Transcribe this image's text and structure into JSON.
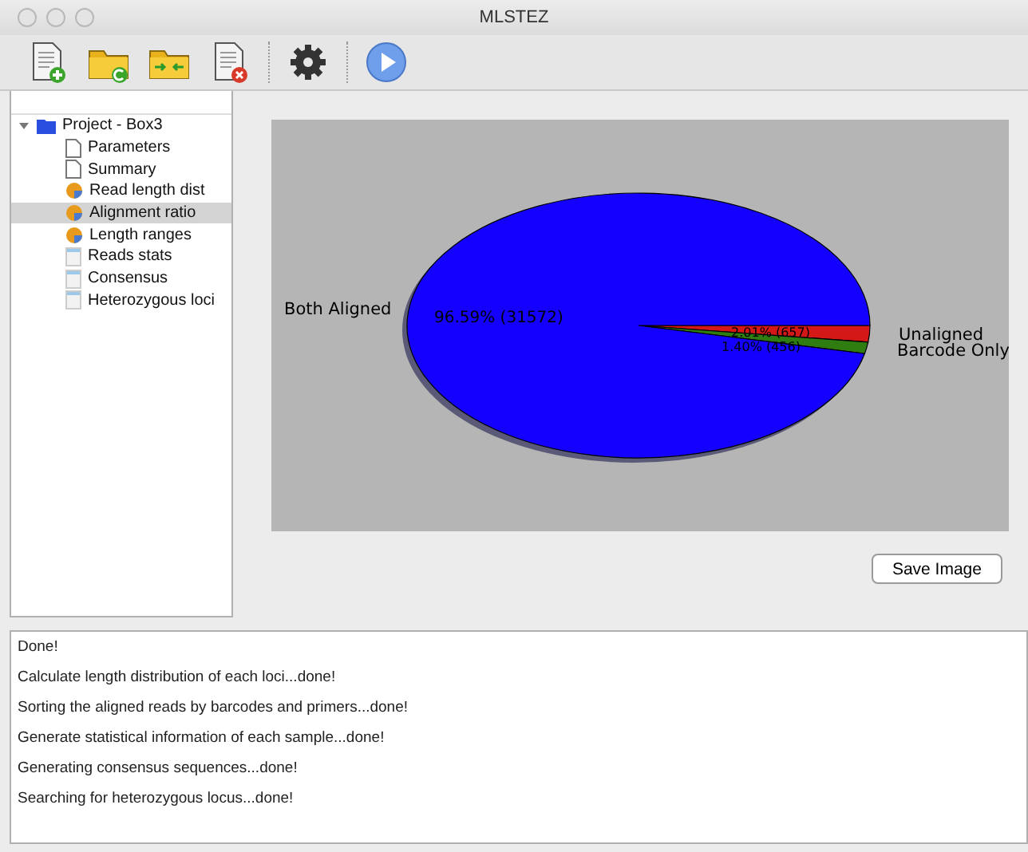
{
  "window": {
    "title": "MLSTEZ"
  },
  "toolbar": [
    {
      "kind": "new-file"
    },
    {
      "kind": "open-folder"
    },
    {
      "kind": "merge-folder"
    },
    {
      "kind": "delete-file"
    },
    {
      "kind": "settings"
    },
    {
      "kind": "run"
    }
  ],
  "tree": {
    "label": "Project - Box3",
    "expanded": true,
    "children": [
      {
        "label": "Parameters",
        "kind": "page",
        "selected": false
      },
      {
        "label": "Summary",
        "kind": "page",
        "selected": false
      },
      {
        "label": "Read length dist",
        "kind": "chart",
        "selected": false
      },
      {
        "label": "Alignment ratio",
        "kind": "chart",
        "selected": true
      },
      {
        "label": "Length ranges",
        "kind": "chart",
        "selected": false
      },
      {
        "label": "Reads stats",
        "kind": "sheet",
        "selected": false
      },
      {
        "label": "Consensus",
        "kind": "sheet",
        "selected": false
      },
      {
        "label": "Heterozygous loci",
        "kind": "sheet",
        "selected": false
      }
    ]
  },
  "chart": {
    "chart_data": {
      "type": "pie",
      "categories": [
        "Both Aligned",
        "Unaligned",
        "Barcode Only"
      ],
      "values": [
        31572,
        657,
        456
      ],
      "colors": [
        "#1400ff",
        "#d41818",
        "#2f7d10"
      ],
      "value_labels": [
        "96.59%  (31572)",
        "2.01%  (657)",
        "1.40%  (456)"
      ]
    }
  },
  "save_button": "Save Image",
  "log": [
    "Done!",
    "Calculate length distribution of each loci...done!",
    "Sorting the aligned reads by barcodes and primers...done!",
    "Generate statistical information of each sample...done!",
    "Generating consensus sequences...done!",
    "Searching for heterozygous locus...done!"
  ]
}
